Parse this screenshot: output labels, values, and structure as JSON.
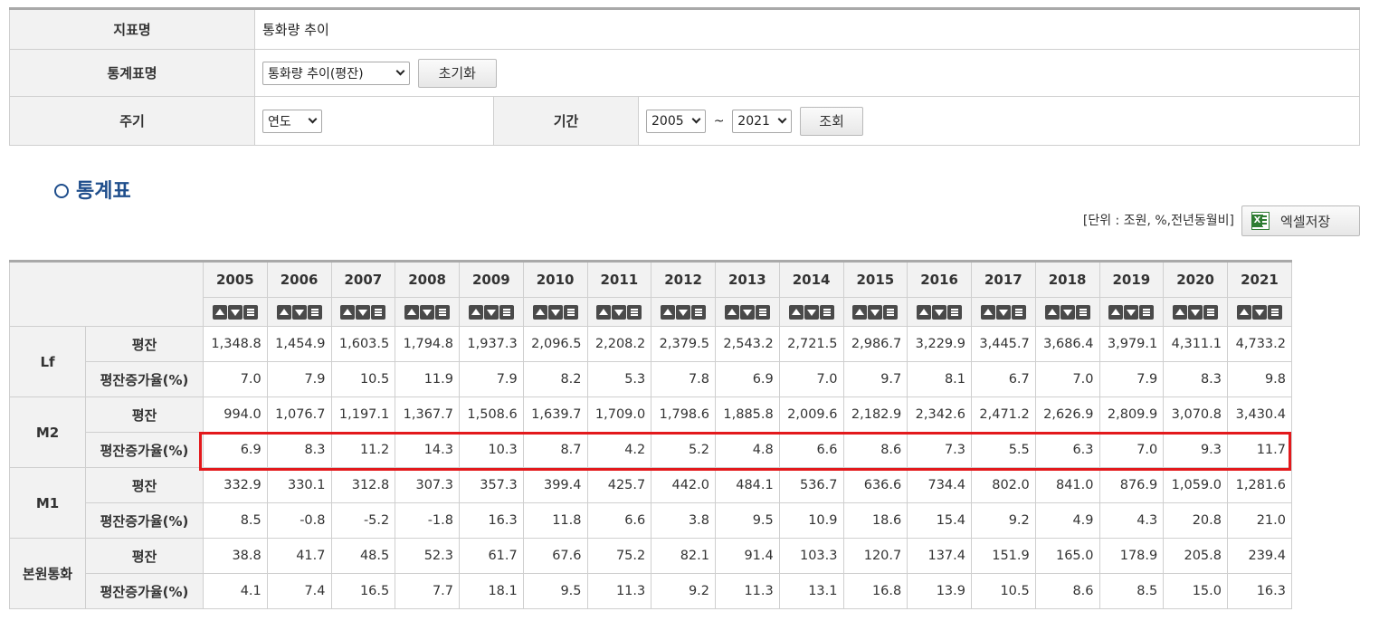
{
  "form": {
    "indicator_label": "지표명",
    "indicator_value": "통화량 추이",
    "stat_table_label": "통계표명",
    "stat_table_value": "통화량 추이(평잔)",
    "reset_label": "초기화",
    "cycle_label": "주기",
    "cycle_value": "연도",
    "period_label": "기간",
    "period_start": "2005",
    "period_tilde": "~",
    "period_end": "2021",
    "search_label": "조회"
  },
  "section_title": "통계표",
  "unit_text": "[단위 : 조원, %,전년동월비]",
  "excel_label": "엑셀저장",
  "table": {
    "years": [
      "2005",
      "2006",
      "2007",
      "2008",
      "2009",
      "2010",
      "2011",
      "2012",
      "2013",
      "2014",
      "2015",
      "2016",
      "2017",
      "2018",
      "2019",
      "2020",
      "2021"
    ],
    "groups": [
      {
        "name": "Lf",
        "rows": [
          {
            "label": "평잔",
            "values": [
              "1,348.8",
              "1,454.9",
              "1,603.5",
              "1,794.8",
              "1,937.3",
              "2,096.5",
              "2,208.2",
              "2,379.5",
              "2,543.2",
              "2,721.5",
              "2,986.7",
              "3,229.9",
              "3,445.7",
              "3,686.4",
              "3,979.1",
              "4,311.1",
              "4,733.2"
            ]
          },
          {
            "label": "평잔증가율(%)",
            "values": [
              "7.0",
              "7.9",
              "10.5",
              "11.9",
              "7.9",
              "8.2",
              "5.3",
              "7.8",
              "6.9",
              "7.0",
              "9.7",
              "8.1",
              "6.7",
              "7.0",
              "7.9",
              "8.3",
              "9.8"
            ]
          }
        ]
      },
      {
        "name": "M2",
        "rows": [
          {
            "label": "평잔",
            "values": [
              "994.0",
              "1,076.7",
              "1,197.1",
              "1,367.7",
              "1,508.6",
              "1,639.7",
              "1,709.0",
              "1,798.6",
              "1,885.8",
              "2,009.6",
              "2,182.9",
              "2,342.6",
              "2,471.2",
              "2,626.9",
              "2,809.9",
              "3,070.8",
              "3,430.4"
            ]
          },
          {
            "label": "평잔증가율(%)",
            "values": [
              "6.9",
              "8.3",
              "11.2",
              "14.3",
              "10.3",
              "8.7",
              "4.2",
              "5.2",
              "4.8",
              "6.6",
              "8.6",
              "7.3",
              "5.5",
              "6.3",
              "7.0",
              "9.3",
              "11.7"
            ]
          }
        ]
      },
      {
        "name": "M1",
        "rows": [
          {
            "label": "평잔",
            "values": [
              "332.9",
              "330.1",
              "312.8",
              "307.3",
              "357.3",
              "399.4",
              "425.7",
              "442.0",
              "484.1",
              "536.7",
              "636.6",
              "734.4",
              "802.0",
              "841.0",
              "876.9",
              "1,059.0",
              "1,281.6"
            ]
          },
          {
            "label": "평잔증가율(%)",
            "values": [
              "8.5",
              "-0.8",
              "-5.2",
              "-1.8",
              "16.3",
              "11.8",
              "6.6",
              "3.8",
              "9.5",
              "10.9",
              "18.6",
              "15.4",
              "9.2",
              "4.9",
              "4.3",
              "20.8",
              "21.0"
            ]
          }
        ]
      },
      {
        "name": "본원통화",
        "rows": [
          {
            "label": "평잔",
            "values": [
              "38.8",
              "41.7",
              "48.5",
              "52.3",
              "61.7",
              "67.6",
              "75.2",
              "82.1",
              "91.4",
              "103.3",
              "120.7",
              "137.4",
              "151.9",
              "165.0",
              "178.9",
              "205.8",
              "239.4"
            ]
          },
          {
            "label": "평잔증가율(%)",
            "values": [
              "4.1",
              "7.4",
              "16.5",
              "7.7",
              "18.1",
              "9.5",
              "11.3",
              "9.2",
              "11.3",
              "13.1",
              "16.8",
              "13.9",
              "10.5",
              "8.6",
              "8.5",
              "15.0",
              "16.3"
            ]
          }
        ]
      }
    ]
  }
}
